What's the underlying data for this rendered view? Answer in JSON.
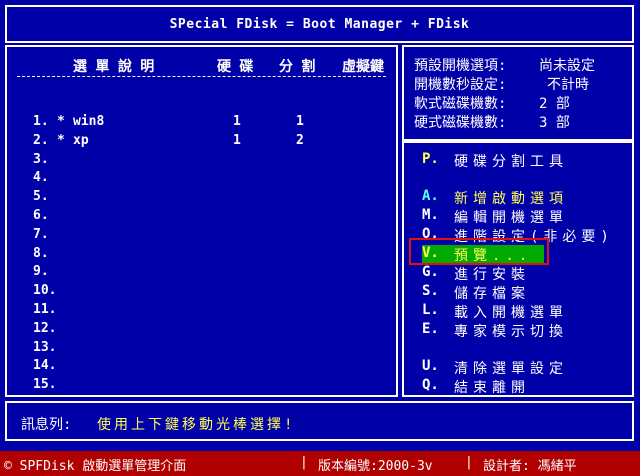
{
  "title": "SPecial FDisk = Boot Manager + FDisk",
  "list": {
    "headers": {
      "description": "選 單 說 明",
      "disk": "硬 碟",
      "partition": "分 割",
      "hotkey": "虛擬鍵"
    },
    "divider": "- - - - - - - - - - - - - - - - - - - - - - - - - - - - - - - - - - - - - - -",
    "entries": [
      {
        "num": "1.",
        "mark": "*",
        "name": "win8",
        "disk": "1",
        "part": "1"
      },
      {
        "num": "2.",
        "mark": "*",
        "name": "xp",
        "disk": "1",
        "part": "2"
      },
      {
        "num": "3."
      },
      {
        "num": "4."
      },
      {
        "num": "5."
      },
      {
        "num": "6."
      },
      {
        "num": "7."
      },
      {
        "num": "8."
      },
      {
        "num": "9."
      },
      {
        "num": "10."
      },
      {
        "num": "11."
      },
      {
        "num": "12."
      },
      {
        "num": "13."
      },
      {
        "num": "14."
      },
      {
        "num": "15."
      }
    ]
  },
  "info": {
    "default_label": "預設開機選項:",
    "default_value": "尚未設定",
    "timeout_label": "開機數秒設定:",
    "timeout_value": "不計時",
    "floppy_label": "軟式磁碟機數:",
    "floppy_value": "2 部",
    "hdd_label": "硬式磁碟機數:",
    "hdd_value": "3 部"
  },
  "menu": {
    "p": {
      "key": "P.",
      "label": "硬碟分割工具"
    },
    "a": {
      "key": "A.",
      "label": "新增啟動選項"
    },
    "m": {
      "key": "M.",
      "label": "編輯開機選單"
    },
    "o": {
      "key": "O.",
      "label": "進階設定(非必要)"
    },
    "v": {
      "key": "V.",
      "label": "預覽..."
    },
    "g": {
      "key": "G.",
      "label": "進行安裝"
    },
    "s": {
      "key": "S.",
      "label": "儲存檔案"
    },
    "l": {
      "key": "L.",
      "label": "載入開機選單"
    },
    "e": {
      "key": "E.",
      "label": "專家模示切換"
    },
    "u": {
      "key": "U.",
      "label": "清除選單設定"
    },
    "q": {
      "key": "Q.",
      "label": "結束離開"
    }
  },
  "message": {
    "label": "訊息列:",
    "text": "使用上下鍵移動光棒選擇!"
  },
  "status": {
    "app": "© SPFDisk 啟動選單管理介面",
    "version": "版本編號:2000-3v",
    "author": "設計者: 馮緒平"
  },
  "colors": {
    "background": "#0000a8",
    "status_bar": "#b00000",
    "highlight": "#00aa00",
    "accent_yellow": "#ffff55",
    "accent_cyan": "#55ffff",
    "annotation_frame": "#e01010"
  }
}
